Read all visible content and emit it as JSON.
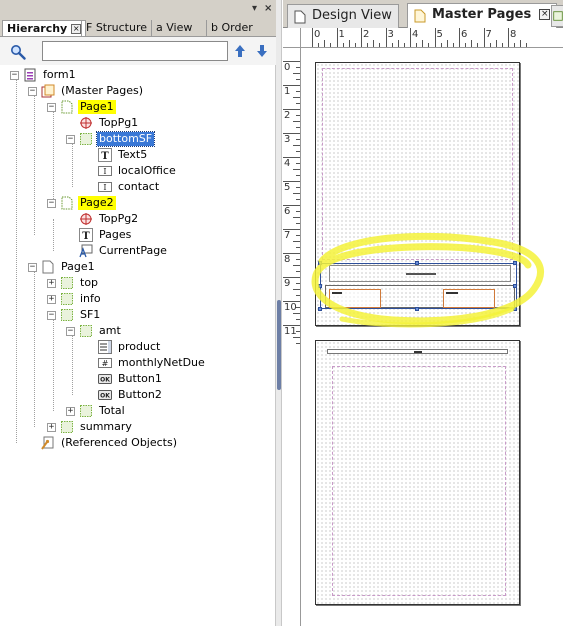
{
  "panel": {
    "tabs": [
      {
        "label": "Hierarchy",
        "active": true
      },
      {
        "label": "PDF Structure",
        "visible_text": "F Structure"
      },
      {
        "label": "Data View",
        "visible_text": "a View"
      },
      {
        "label": "Tab Order",
        "visible_text": "b Order"
      }
    ],
    "controls": {
      "dropdown": "▾",
      "close": "×"
    },
    "search": {
      "value": "",
      "placeholder": ""
    },
    "icons": [
      "search-icon",
      "arrow-up-icon",
      "arrow-down-icon"
    ]
  },
  "tree": [
    {
      "label": "form1",
      "icon": "form-icon",
      "expanded": true
    },
    {
      "label": "(Master Pages)",
      "icon": "master-pages-icon",
      "expanded": true
    },
    {
      "label": "Page1",
      "icon": "page-icon",
      "expanded": true,
      "highlight": "yellow"
    },
    {
      "label": "TopPg1",
      "icon": "content-area-icon"
    },
    {
      "label": "bottomSF",
      "icon": "subform-icon",
      "expanded": true,
      "selected": true
    },
    {
      "label": "Text5",
      "icon": "text-icon"
    },
    {
      "label": "localOffice",
      "icon": "textfield-icon"
    },
    {
      "label": "contact",
      "icon": "textfield-icon"
    },
    {
      "label": "Page2",
      "icon": "page-icon",
      "expanded": true,
      "highlight": "yellow"
    },
    {
      "label": "TopPg2",
      "icon": "content-area-icon"
    },
    {
      "label": "Pages",
      "icon": "text-icon"
    },
    {
      "label": "CurrentPage",
      "icon": "page-number-icon"
    },
    {
      "label": "Page1",
      "icon": "body-page-icon",
      "expanded": true
    },
    {
      "label": "top",
      "icon": "subform-icon",
      "expanded": false
    },
    {
      "label": "info",
      "icon": "subform-icon",
      "expanded": false
    },
    {
      "label": "SF1",
      "icon": "subform-icon",
      "expanded": true
    },
    {
      "label": "amt",
      "icon": "subform-icon",
      "expanded": true
    },
    {
      "label": "product",
      "icon": "dropdown-list-icon"
    },
    {
      "label": "monthlyNetDue",
      "icon": "numeric-field-icon"
    },
    {
      "label": "Button1",
      "icon": "button-icon"
    },
    {
      "label": "Button2",
      "icon": "button-icon"
    },
    {
      "label": "Total",
      "icon": "subform-icon",
      "expanded": false
    },
    {
      "label": "summary",
      "icon": "subform-icon",
      "expanded": false
    },
    {
      "label": "(Referenced Objects)",
      "icon": "referenced-objects-icon"
    }
  ],
  "icon_glyphs": {
    "text": "T",
    "textfield": "I",
    "numeric": "#",
    "button": "OK"
  },
  "doc_tabs": [
    {
      "label": "Design View",
      "active": false
    },
    {
      "label": "Master Pages",
      "active": true
    }
  ],
  "ruler": {
    "h_ticks": [
      "0",
      "1",
      "2",
      "3",
      "4",
      "5",
      "6",
      "7",
      "8"
    ],
    "v_ticks": [
      "0",
      "1",
      "2",
      "3",
      "4",
      "5",
      "6",
      "7",
      "8",
      "9",
      "10",
      "11"
    ]
  },
  "colors": {
    "highlight": "#ffff00",
    "selection": "#3a78d6",
    "subform_green": "#7cb342",
    "annotation_yellow": "#f4f23a"
  }
}
